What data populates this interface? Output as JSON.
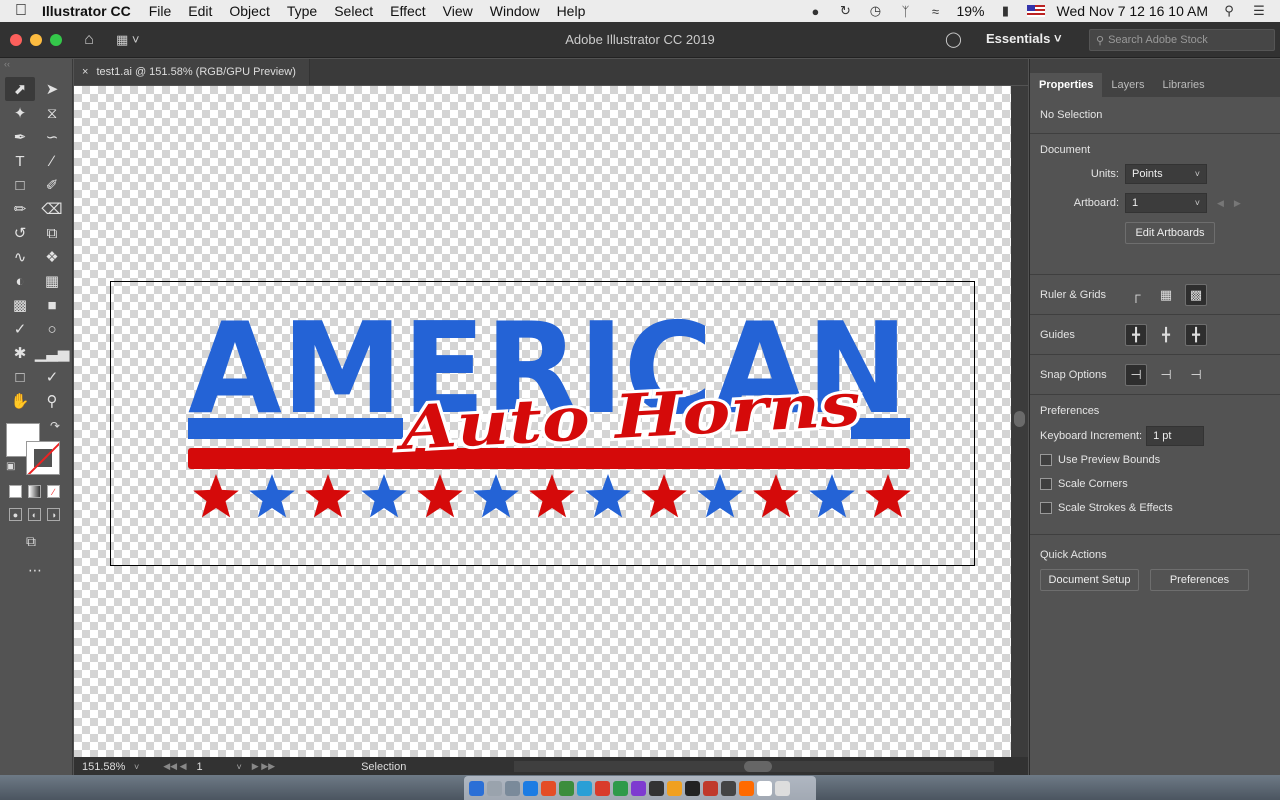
{
  "menubar": {
    "apple": "",
    "app_name": "Illustrator CC",
    "items": [
      "File",
      "Edit",
      "Object",
      "Type",
      "Select",
      "Effect",
      "View",
      "Window",
      "Help"
    ],
    "battery": "19%",
    "clock": "Wed Nov 7  12 16 10 AM"
  },
  "appbar": {
    "title": "Adobe Illustrator CC 2019",
    "workspace": "Essentials",
    "search_placeholder": "Search Adobe Stock"
  },
  "document": {
    "tab_label": "test1.ai @ 151.58% (RGB/GPU Preview)",
    "close_glyph": "×"
  },
  "artwork": {
    "headline": "AMERICAN",
    "script": "Auto Horns",
    "colors": {
      "blue": "#2463d6",
      "red": "#d50a0a"
    },
    "stars": [
      "red",
      "blue",
      "red",
      "blue",
      "red",
      "blue",
      "red",
      "blue",
      "red",
      "blue",
      "red",
      "blue",
      "red"
    ]
  },
  "statusbar": {
    "zoom": "151.58%",
    "artboard_number": "1",
    "tool": "Selection"
  },
  "panel": {
    "tabs": [
      "Properties",
      "Layers",
      "Libraries"
    ],
    "selection_status": "No Selection",
    "document_heading": "Document",
    "units_label": "Units:",
    "units_value": "Points",
    "artboard_label": "Artboard:",
    "artboard_value": "1",
    "edit_artboards": "Edit Artboards",
    "ruler_grids": "Ruler & Grids",
    "guides": "Guides",
    "snap_options": "Snap Options",
    "preferences_heading": "Preferences",
    "keyboard_increment_label": "Keyboard Increment:",
    "keyboard_increment_value": "1 pt",
    "checkboxes": [
      "Use Preview Bounds",
      "Scale Corners",
      "Scale Strokes & Effects"
    ],
    "quick_actions_heading": "Quick Actions",
    "document_setup": "Document Setup",
    "preferences_button": "Preferences"
  },
  "dock_colors": [
    "#2b6fd6",
    "#9aa3ad",
    "#7a8a9a",
    "#1c7ce3",
    "#e44d26",
    "#3c8d3c",
    "#2a9fd6",
    "#d93b2b",
    "#2e9a4a",
    "#7e3bd0",
    "#333333",
    "#f0a020",
    "#222222",
    "#c0392b",
    "#444444",
    "#ff6a00",
    "#ffffff",
    "#dddddd"
  ]
}
